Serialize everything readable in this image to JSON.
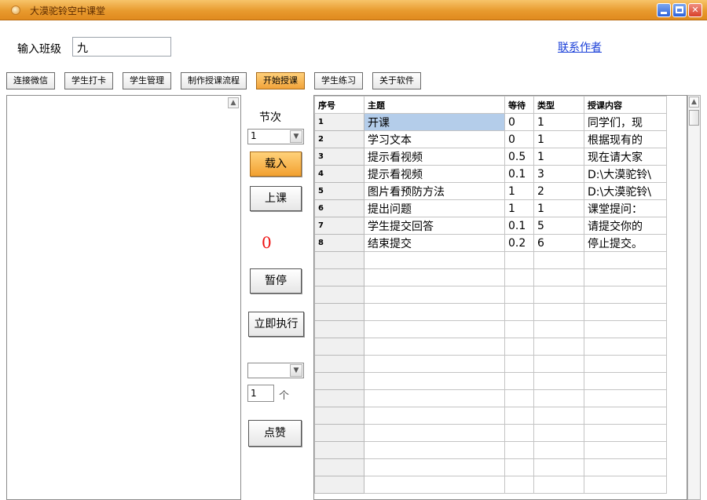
{
  "window": {
    "title": "大漠驼铃空中课堂"
  },
  "header": {
    "class_label": "输入班级",
    "class_value": "九",
    "contact_link": "联系作者"
  },
  "tabs": [
    {
      "label": "连接微信"
    },
    {
      "label": "学生打卡"
    },
    {
      "label": "学生管理"
    },
    {
      "label": "制作授课流程"
    },
    {
      "label": "开始授课",
      "active": true
    },
    {
      "label": "学生练习"
    },
    {
      "label": "关于软件"
    }
  ],
  "controls": {
    "lesson_label": "节次",
    "lesson_value": "1",
    "load_button": "载入",
    "class_button": "上课",
    "counter": "0",
    "pause_button": "暂停",
    "run_now_button": "立即执行",
    "count_value": "1",
    "count_unit": "个",
    "like_button": "点赞"
  },
  "grid": {
    "columns": [
      "序号",
      "主题",
      "等待",
      "类型",
      "授课内容"
    ],
    "rows": [
      {
        "no": "1",
        "topic": "开课",
        "wait": "0",
        "type": "1",
        "content": "同学们，现"
      },
      {
        "no": "2",
        "topic": "学习文本",
        "wait": "0",
        "type": "1",
        "content": "根据现有的"
      },
      {
        "no": "3",
        "topic": "提示看视频",
        "wait": "0.5",
        "type": "1",
        "content": "现在请大家"
      },
      {
        "no": "4",
        "topic": "提示看视频",
        "wait": "0.1",
        "type": "3",
        "content": "D:\\大漠驼铃\\"
      },
      {
        "no": "5",
        "topic": "图片看预防方法",
        "wait": "1",
        "type": "2",
        "content": "D:\\大漠驼铃\\"
      },
      {
        "no": "6",
        "topic": "提出问题",
        "wait": "1",
        "type": "1",
        "content": "课堂提问："
      },
      {
        "no": "7",
        "topic": "学生提交回答",
        "wait": "0.1",
        "type": "5",
        "content": "请提交你的"
      },
      {
        "no": "8",
        "topic": "结束提交",
        "wait": "0.2",
        "type": "6",
        "content": "停止提交。"
      }
    ]
  },
  "colors": {
    "titlebar": "#e89a2e",
    "active_tab": "#f2a030",
    "link": "#1a3fd8",
    "counter": "#ee1111",
    "selection": "#b4cdea"
  }
}
